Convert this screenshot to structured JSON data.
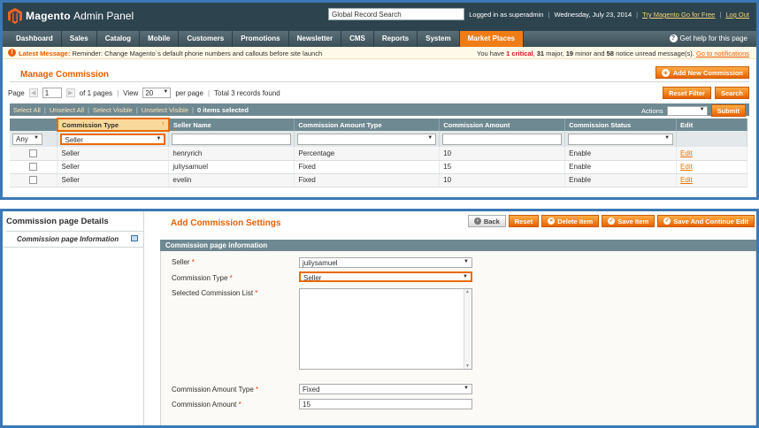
{
  "header": {
    "app_title": "Magento",
    "app_subtitle": "Admin Panel",
    "search_value": "Global Record Search",
    "logged_in": "Logged in as superadmin",
    "date": "Wednesday, July 23, 2014",
    "try_link": "Try Magento Go for Free",
    "logout": "Log Out"
  },
  "nav": {
    "items": [
      "Dashboard",
      "Sales",
      "Catalog",
      "Mobile",
      "Customers",
      "Promotions",
      "Newsletter",
      "CMS",
      "Reports",
      "System",
      "Market Places"
    ],
    "help": "Get help for this page"
  },
  "message": {
    "label": "Latest Message:",
    "text": "Reminder: Change Magento`s default phone numbers and callouts before site launch",
    "prefix": "You have",
    "critical": "1 critical",
    "major": "31",
    "major_suffix": "major,",
    "minor": "19",
    "minor_suffix": "minor and",
    "notice": "58",
    "notice_suffix": "notice unread message(s).",
    "link": "Go to notifications"
  },
  "manage": {
    "title": "Manage Commission",
    "add_button": "Add New Commission",
    "page_label": "Page",
    "page_value": "1",
    "of_pages": "of 1 pages",
    "view_label": "View",
    "per_page_value": "20",
    "per_page": "per page",
    "total": "Total 3 records found",
    "reset_filter": "Reset Filter",
    "search": "Search",
    "mass": {
      "select_all": "Select All",
      "unselect_all": "Unselect All",
      "select_visible": "Select Visible",
      "unselect_visible": "Unselect Visible",
      "items_selected": "0 items selected",
      "actions_label": "Actions",
      "submit": "Submit"
    },
    "columns": [
      "Commission Type",
      "Seller Name",
      "Commission Amount Type",
      "Commission Amount",
      "Commission Status",
      "Edit"
    ],
    "filter": {
      "any": "Any",
      "type": "Seller"
    },
    "rows": [
      {
        "type": "Seller",
        "name": "henryrich",
        "amount_type": "Percentage",
        "amount": "10",
        "status": "Enable",
        "edit": "Edit"
      },
      {
        "type": "Seller",
        "name": "juliysamuel",
        "amount_type": "Fixed",
        "amount": "15",
        "status": "Enable",
        "edit": "Edit"
      },
      {
        "type": "Seller",
        "name": "evelin",
        "amount_type": "Fixed",
        "amount": "10",
        "status": "Enable",
        "edit": "Edit"
      }
    ]
  },
  "details": {
    "sidebar_title": "Commission page Details",
    "sidebar_tab": "Commission page Information",
    "title": "Add Commission Settings",
    "buttons": {
      "back": "Back",
      "reset": "Reset",
      "delete": "Delete Item",
      "save": "Save Item",
      "save_continue": "Save And Continue Edit"
    },
    "fieldset_title": "Commission page information",
    "fields": {
      "seller_label": "Seller",
      "seller_value": "juliysamuel",
      "type_label": "Commission Type",
      "type_value": "Seller",
      "list_label": "Selected Commission List",
      "amount_type_label": "Commission Amount Type",
      "amount_type_value": "Fixed",
      "amount_label": "Commission Amount",
      "amount_value": "15"
    }
  },
  "colors": {
    "accent": "#eb5e00",
    "header_bg": "#2d444f",
    "grid_head": "#6f8992",
    "frame": "#3c78b5"
  }
}
